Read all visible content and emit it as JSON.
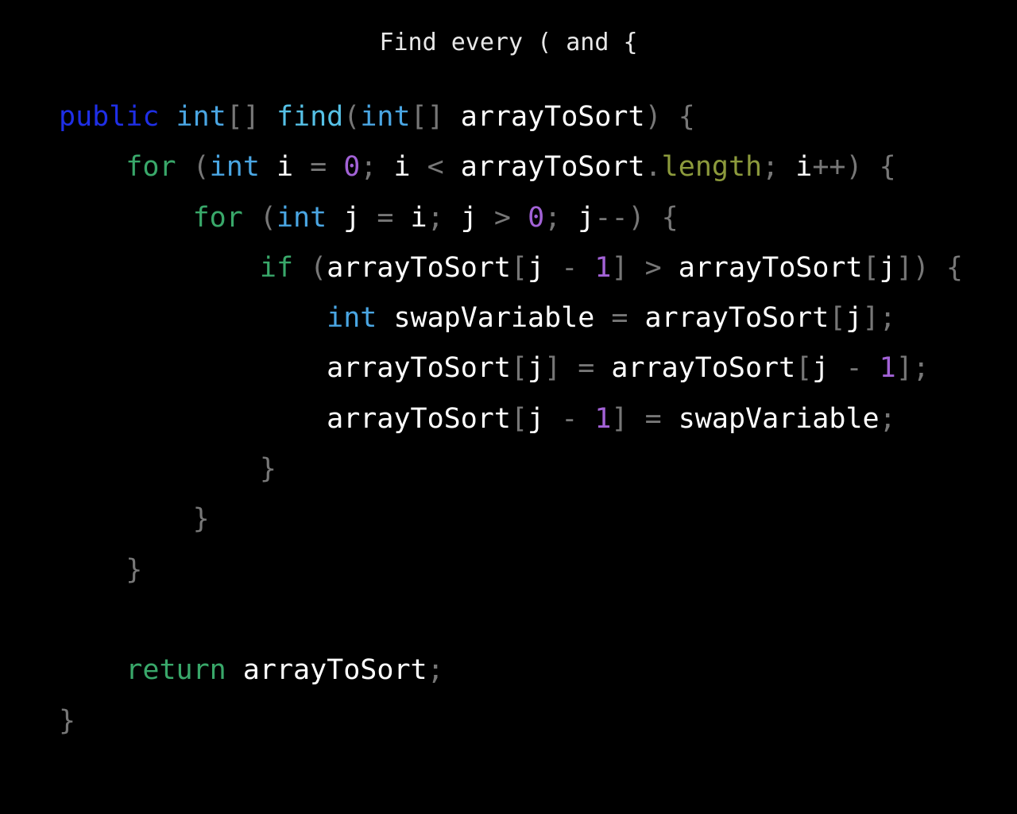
{
  "prompt": "Find every ( and {",
  "colors": {
    "background": "#000000",
    "modifier": "#1f2fe6",
    "keyword": "#39a86a",
    "type": "#4aa6e3",
    "function": "#56c1e6",
    "number": "#a262d6",
    "punctuation": "#777777",
    "identifier": "#ffffff",
    "property": "#8c9a3c"
  },
  "code_lines": [
    {
      "indent": "",
      "tokens": [
        {
          "t": "public",
          "k": "mod"
        },
        {
          "t": " ",
          "k": "ident"
        },
        {
          "t": "int",
          "k": "type"
        },
        {
          "t": "[]",
          "k": "punc"
        },
        {
          "t": " ",
          "k": "ident"
        },
        {
          "t": "find",
          "k": "fn"
        },
        {
          "t": "(",
          "k": "punc"
        },
        {
          "t": "int",
          "k": "type"
        },
        {
          "t": "[]",
          "k": "punc"
        },
        {
          "t": " arrayToSort",
          "k": "ident"
        },
        {
          "t": ") {",
          "k": "punc"
        }
      ]
    },
    {
      "indent": "    ",
      "tokens": [
        {
          "t": "for",
          "k": "kw"
        },
        {
          "t": " (",
          "k": "punc"
        },
        {
          "t": "int",
          "k": "type"
        },
        {
          "t": " i ",
          "k": "ident"
        },
        {
          "t": "=",
          "k": "punc"
        },
        {
          "t": " ",
          "k": "ident"
        },
        {
          "t": "0",
          "k": "num"
        },
        {
          "t": ";",
          "k": "punc"
        },
        {
          "t": " i ",
          "k": "ident"
        },
        {
          "t": "<",
          "k": "punc"
        },
        {
          "t": " arrayToSort",
          "k": "ident"
        },
        {
          "t": ".",
          "k": "punc"
        },
        {
          "t": "length",
          "k": "prop"
        },
        {
          "t": ";",
          "k": "punc"
        },
        {
          "t": " i",
          "k": "ident"
        },
        {
          "t": "++) {",
          "k": "punc"
        }
      ]
    },
    {
      "indent": "        ",
      "tokens": [
        {
          "t": "for",
          "k": "kw"
        },
        {
          "t": " (",
          "k": "punc"
        },
        {
          "t": "int",
          "k": "type"
        },
        {
          "t": " j ",
          "k": "ident"
        },
        {
          "t": "=",
          "k": "punc"
        },
        {
          "t": " i",
          "k": "ident"
        },
        {
          "t": ";",
          "k": "punc"
        },
        {
          "t": " j ",
          "k": "ident"
        },
        {
          "t": ">",
          "k": "punc"
        },
        {
          "t": " ",
          "k": "ident"
        },
        {
          "t": "0",
          "k": "num"
        },
        {
          "t": ";",
          "k": "punc"
        },
        {
          "t": " j",
          "k": "ident"
        },
        {
          "t": "--) {",
          "k": "punc"
        }
      ]
    },
    {
      "indent": "            ",
      "tokens": [
        {
          "t": "if",
          "k": "kw"
        },
        {
          "t": " (",
          "k": "punc"
        },
        {
          "t": "arrayToSort",
          "k": "ident"
        },
        {
          "t": "[",
          "k": "punc"
        },
        {
          "t": "j ",
          "k": "ident"
        },
        {
          "t": "-",
          "k": "punc"
        },
        {
          "t": " ",
          "k": "ident"
        },
        {
          "t": "1",
          "k": "num"
        },
        {
          "t": "]",
          "k": "punc"
        },
        {
          "t": " ",
          "k": "ident"
        },
        {
          "t": ">",
          "k": "punc"
        },
        {
          "t": " arrayToSort",
          "k": "ident"
        },
        {
          "t": "[",
          "k": "punc"
        },
        {
          "t": "j",
          "k": "ident"
        },
        {
          "t": "]) {",
          "k": "punc"
        }
      ]
    },
    {
      "indent": "                ",
      "tokens": [
        {
          "t": "int",
          "k": "type"
        },
        {
          "t": " swapVariable ",
          "k": "ident"
        },
        {
          "t": "=",
          "k": "punc"
        },
        {
          "t": " arrayToSort",
          "k": "ident"
        },
        {
          "t": "[",
          "k": "punc"
        },
        {
          "t": "j",
          "k": "ident"
        },
        {
          "t": "];",
          "k": "punc"
        }
      ]
    },
    {
      "indent": "                ",
      "tokens": [
        {
          "t": "arrayToSort",
          "k": "ident"
        },
        {
          "t": "[",
          "k": "punc"
        },
        {
          "t": "j",
          "k": "ident"
        },
        {
          "t": "]",
          "k": "punc"
        },
        {
          "t": " ",
          "k": "ident"
        },
        {
          "t": "=",
          "k": "punc"
        },
        {
          "t": " arrayToSort",
          "k": "ident"
        },
        {
          "t": "[",
          "k": "punc"
        },
        {
          "t": "j ",
          "k": "ident"
        },
        {
          "t": "-",
          "k": "punc"
        },
        {
          "t": " ",
          "k": "ident"
        },
        {
          "t": "1",
          "k": "num"
        },
        {
          "t": "];",
          "k": "punc"
        }
      ]
    },
    {
      "indent": "                ",
      "tokens": [
        {
          "t": "arrayToSort",
          "k": "ident"
        },
        {
          "t": "[",
          "k": "punc"
        },
        {
          "t": "j ",
          "k": "ident"
        },
        {
          "t": "-",
          "k": "punc"
        },
        {
          "t": " ",
          "k": "ident"
        },
        {
          "t": "1",
          "k": "num"
        },
        {
          "t": "]",
          "k": "punc"
        },
        {
          "t": " ",
          "k": "ident"
        },
        {
          "t": "=",
          "k": "punc"
        },
        {
          "t": " swapVariable",
          "k": "ident"
        },
        {
          "t": ";",
          "k": "punc"
        }
      ]
    },
    {
      "indent": "            ",
      "tokens": [
        {
          "t": "}",
          "k": "punc"
        }
      ]
    },
    {
      "indent": "        ",
      "tokens": [
        {
          "t": "}",
          "k": "punc"
        }
      ]
    },
    {
      "indent": "    ",
      "tokens": [
        {
          "t": "}",
          "k": "punc"
        }
      ]
    },
    {
      "indent": "",
      "tokens": []
    },
    {
      "indent": "    ",
      "tokens": [
        {
          "t": "return",
          "k": "kw"
        },
        {
          "t": " arrayToSort",
          "k": "ident"
        },
        {
          "t": ";",
          "k": "punc"
        }
      ]
    },
    {
      "indent": "",
      "tokens": [
        {
          "t": "}",
          "k": "punc"
        }
      ]
    }
  ]
}
